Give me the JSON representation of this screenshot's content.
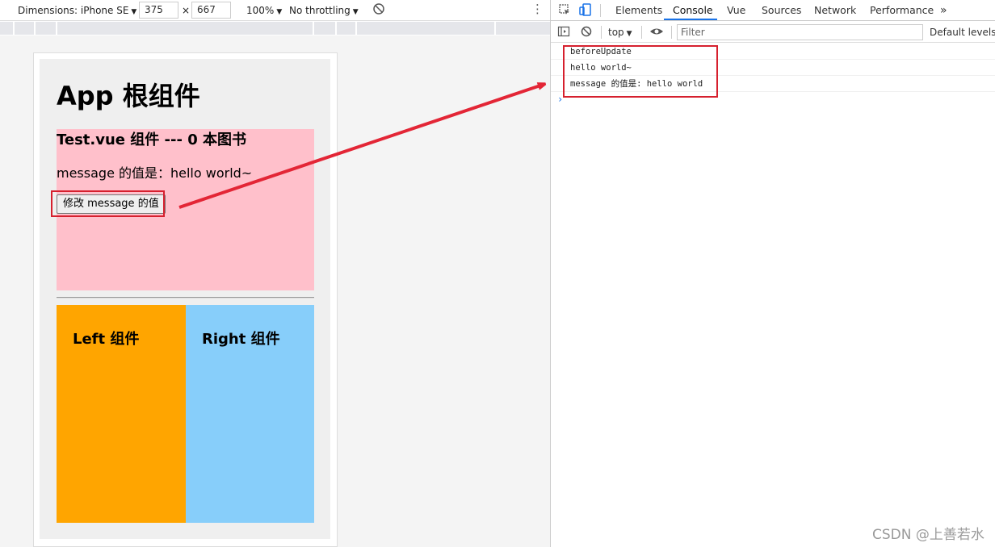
{
  "emulation": {
    "device_label": "Dimensions: iPhone SE",
    "width_value": "375",
    "times": "×",
    "height_value": "667",
    "zoom": "100%",
    "throttling": "No throttling"
  },
  "app": {
    "title": "App 根组件",
    "test_title": "Test.vue 组件 --- 0 本图书",
    "message_line": "message 的值是：hello world~",
    "change_button": "修改 message 的值",
    "left_title": "Left 组件",
    "right_title": "Right 组件"
  },
  "devtools": {
    "tabs": [
      {
        "label": "Elements"
      },
      {
        "label": "Console"
      },
      {
        "label": "Vue"
      },
      {
        "label": "Sources"
      },
      {
        "label": "Network"
      },
      {
        "label": "Performance"
      }
    ],
    "more_tabs": "»",
    "context": "top",
    "filter_placeholder": "Filter",
    "levels": "Default levels",
    "log": [
      "beforeUpdate",
      "hello world~",
      "message 的值是: hello world"
    ],
    "prompt": "›"
  },
  "colors": {
    "highlight": "#d6202e",
    "pink": "#ffc0cb",
    "orange": "#ffa500",
    "lightblue": "#87cefa"
  },
  "watermark": "CSDN @上善若水"
}
